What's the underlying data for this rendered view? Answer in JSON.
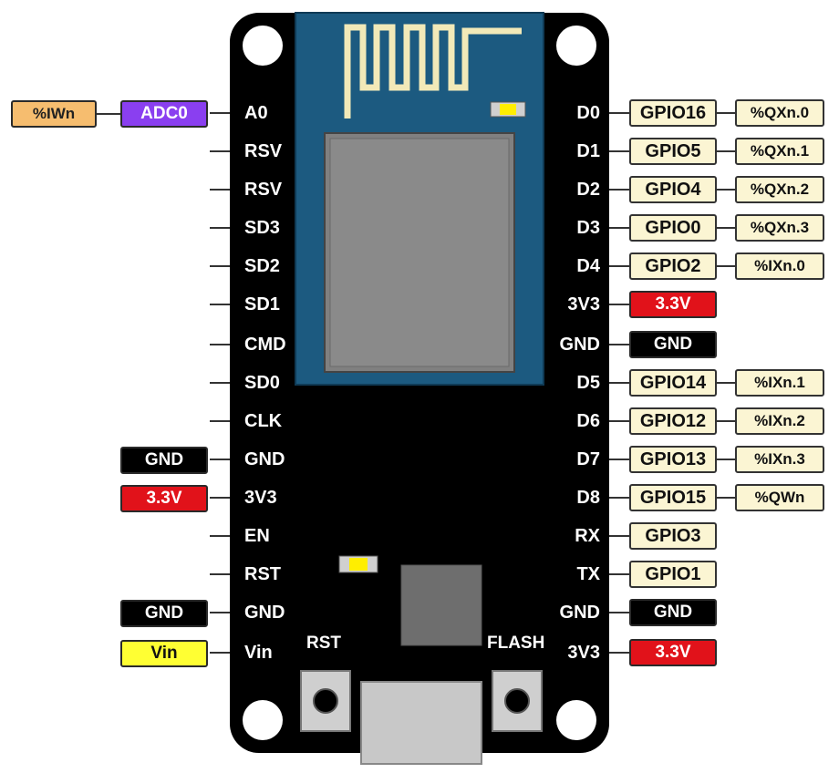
{
  "left_pins": [
    "A0",
    "RSV",
    "RSV",
    "SD3",
    "SD2",
    "SD1",
    "CMD",
    "SD0",
    "CLK",
    "GND",
    "3V3",
    "EN",
    "RST",
    "GND",
    "Vin"
  ],
  "right_pins": [
    "D0",
    "D1",
    "D2",
    "D3",
    "D4",
    "3V3",
    "GND",
    "D5",
    "D6",
    "D7",
    "D8",
    "RX",
    "TX",
    "GND",
    "3V3"
  ],
  "left_tags": {
    "a0_plc": "%IWn",
    "a0_func": "ADC0",
    "gnd_1": "GND",
    "v33": "3.3V",
    "gnd_2": "GND",
    "vin": "Vin"
  },
  "right_tags": {
    "gpio": [
      "GPIO16",
      "GPIO5",
      "GPIO4",
      "GPIO0",
      "GPIO2",
      "3.3V",
      "GND",
      "GPIO14",
      "GPIO12",
      "GPIO13",
      "GPIO15",
      "GPIO3",
      "GPIO1",
      "GND",
      "3.3V"
    ],
    "plc": [
      "%QXn.0",
      "%QXn.1",
      "%QXn.2",
      "%QXn.3",
      "%IXn.0",
      "",
      "",
      "%IXn.1",
      "%IXn.2",
      "%IXn.3",
      "%QWn"
    ]
  },
  "buttons": {
    "rst": "RST",
    "flash": "FLASH"
  },
  "colors": {
    "board": "#000000",
    "module": "#1c5a80",
    "antenna": "#f2e9b8",
    "chip": "#808080",
    "gnd": "#000000",
    "power": "#e1121a",
    "gpio": "#fbf5d3",
    "adc": "#8a3ff0",
    "analog_plc": "#f6bd6f",
    "vin": "#ffff33",
    "led": "#ffee00"
  }
}
